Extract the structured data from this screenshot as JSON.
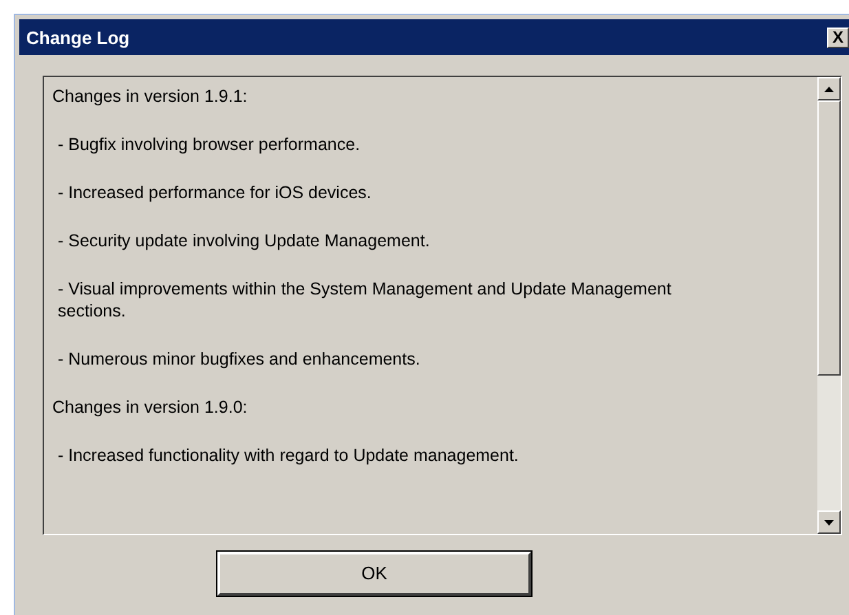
{
  "window": {
    "title": "Change Log",
    "close_button": "X"
  },
  "log": [
    {
      "kind": "heading",
      "text": "Changes in version 1.9.1:"
    },
    {
      "kind": "item",
      "text": "- Bugfix involving browser performance."
    },
    {
      "kind": "item",
      "text": "- Increased performance for iOS devices."
    },
    {
      "kind": "item",
      "text": "- Security update involving Update Management."
    },
    {
      "kind": "item",
      "text": "- Visual improvements within the System Management and Update Management sections."
    },
    {
      "kind": "item",
      "text": "- Numerous minor bugfixes and enhancements."
    },
    {
      "kind": "heading",
      "text": "Changes in version 1.9.0:"
    },
    {
      "kind": "item",
      "text": "- Increased functionality with regard to Update management."
    }
  ],
  "buttons": [
    "OK"
  ]
}
